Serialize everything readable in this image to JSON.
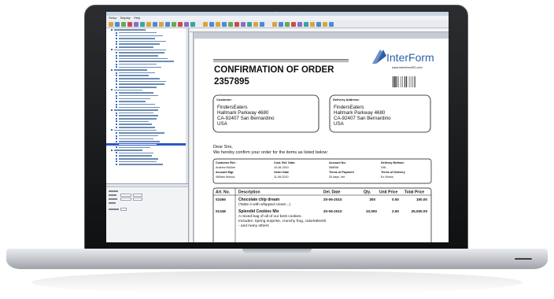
{
  "menubar": {
    "items": [
      "Setup",
      "Display",
      "Help"
    ]
  },
  "document": {
    "title": "CONFIRMATION OF ORDER",
    "order_number": "2357895",
    "brand": "InterForm",
    "brand_url": "www.interform400.com",
    "customer": {
      "heading": "Customer:",
      "lines": [
        "FindersEaters",
        "Hallmark Parkway 4680",
        "CA-92407  San Bernardino",
        "USA"
      ]
    },
    "delivery": {
      "heading": "Delivery Address:",
      "lines": [
        "FindersEaters",
        "Hallmark Parkway 4680",
        "CA-92407  San Bernardino",
        "USA"
      ]
    },
    "greeting": "Dear Sirs,",
    "intro": "We hereby confirm your order for the items as listed below:",
    "info": {
      "h1": [
        "Customer Ref.:",
        "Cust. Ref. Date:",
        "Account No.",
        "Delivery Method:"
      ],
      "v1": [
        "Andrew McDee",
        "10-06-2010",
        "588558",
        "DHL"
      ],
      "h2": [
        "Account Mgr.",
        "Order Date",
        "Terms of Payment",
        "Terms of Delivery"
      ],
      "v2": [
        "William Wonca",
        "11-06-2010",
        "30 days. net",
        "Ex Works"
      ]
    },
    "items_header": [
      "Art. No.",
      "Description",
      "Del. Date",
      "Qty.",
      "Unit Price",
      "Total Price"
    ],
    "items": [
      {
        "art": "02456",
        "desc": "Chocolate chip dream",
        "sub": [
          "(Taste it with whipped cream...)"
        ],
        "date": "20-06-2010",
        "qty": "300",
        "unit": "0.50",
        "total": "150.00"
      },
      {
        "art": "01348",
        "desc": "Splendid Cookies Mix",
        "sub": [
          "A mixed bag of all of our best cookies.",
          "Includes: Spring surprise, crunchy frog, calorieBomb",
          "- and many others"
        ],
        "date": "20-06-2010",
        "qty": "10,000",
        "unit": "2.50",
        "total": "25,000.00"
      }
    ]
  },
  "colors": {
    "brand_blue": "#2d5fa8",
    "selection": "#2c57c9",
    "bezel": "#1b1c1e"
  }
}
